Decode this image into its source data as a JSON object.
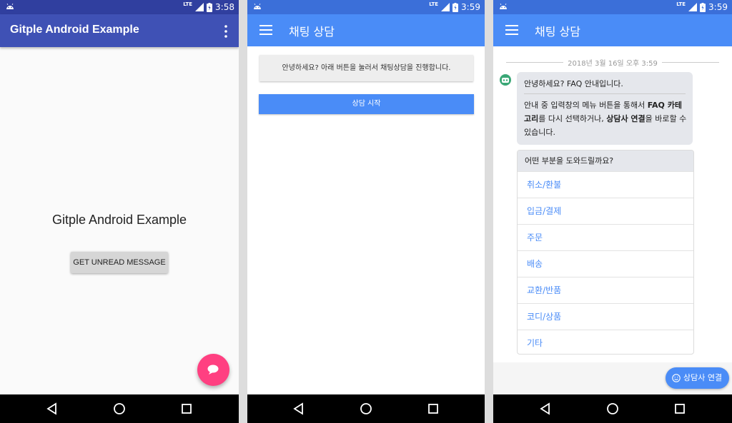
{
  "screen1": {
    "status_time": "3:58",
    "status_network": "LTE",
    "app_title": "Gitple Android Example",
    "center_title": "Gitple Android Example",
    "unread_button": "GET UNREAD MESSAGE",
    "colors": {
      "appbar": "#3f51b5",
      "statusbar": "#303f9f",
      "fab": "#ff4081"
    }
  },
  "screen2": {
    "status_time": "3:59",
    "status_network": "LTE",
    "title": "채팅 상담",
    "notice": "안녕하세요? 아래 버튼을 눌러서 채팅상담을 진행합니다.",
    "start_button": "상담 시작",
    "colors": {
      "appbar": "#4a8cf7"
    }
  },
  "screen3": {
    "status_time": "3:59",
    "status_network": "LTE",
    "title": "채팅 상담",
    "date_separator": "2018년 3월 16일 오후 3:59",
    "bubble": {
      "greeting": "안녕하세요? FAQ 안내입니다.",
      "body_pre": "안내 중 입력창의 메뉴 버튼을 통해서 ",
      "body_bold1": "FAQ 카테고리",
      "body_mid": "를 다시 선택하거나, ",
      "body_bold2": "상담사 연결",
      "body_post": "을 바로할 수 있습니다."
    },
    "faq": {
      "header": "어떤 부분을 도와드릴까요?",
      "items": [
        "취소/환불",
        "입금/결제",
        "주문",
        "배송",
        "교환/반품",
        "코디/상품",
        "기타"
      ]
    },
    "connect_button": "상담사 연결",
    "colors": {
      "accent": "#4a8cf7"
    }
  }
}
